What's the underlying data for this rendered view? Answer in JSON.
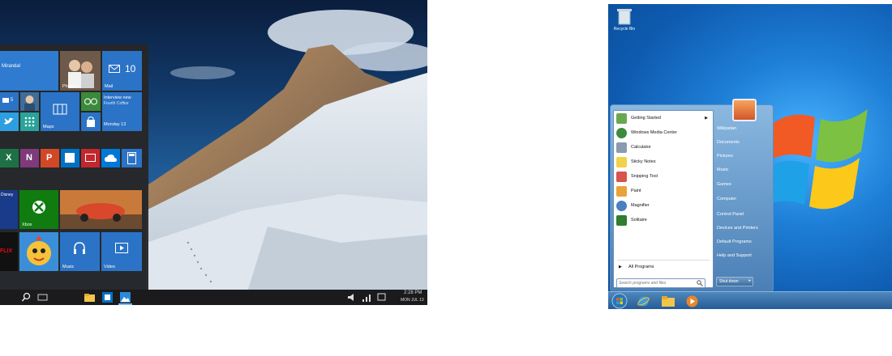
{
  "win10": {
    "start": {
      "tiles": {
        "people_name": "Miranda!",
        "mail_label": "Mail",
        "mail_count": "10",
        "photos_label": "Photos",
        "people_count": "5",
        "maps_label": "Maps",
        "interview_title": "Interview new",
        "interview_sub": "Fourth Coffee",
        "interview_date": "Monday 13",
        "xbox_label": "Xbox",
        "music_label": "Music",
        "video_label": "Video",
        "flix_label": "FLIX",
        "disney_label": "Disney"
      }
    },
    "taskbar": {
      "time": "2:28 PM",
      "date": "MON JUL 13"
    }
  },
  "win7": {
    "desktop": {
      "recycle_bin_label": "Recycle Bin"
    },
    "start_menu": {
      "programs": [
        {
          "label": "Getting Started",
          "icon": "getting-started-icon",
          "color": "#6aa84f"
        },
        {
          "label": "Windows Media Center",
          "icon": "media-center-icon",
          "color": "#3d8a3d"
        },
        {
          "label": "Calculator",
          "icon": "calculator-icon",
          "color": "#8a9bb0"
        },
        {
          "label": "Sticky Notes",
          "icon": "sticky-notes-icon",
          "color": "#f2d24a"
        },
        {
          "label": "Snipping Tool",
          "icon": "snipping-tool-icon",
          "color": "#d9534f"
        },
        {
          "label": "Paint",
          "icon": "paint-icon",
          "color": "#e8a33c"
        },
        {
          "label": "Magnifier",
          "icon": "magnifier-icon",
          "color": "#4a7fc1"
        },
        {
          "label": "Solitaire",
          "icon": "solitaire-icon",
          "color": "#2f7d2f"
        }
      ],
      "all_programs_label": "All Programs",
      "search_placeholder": "Search programs and files",
      "right_items": [
        "Wikipetan",
        "Documents",
        "Pictures",
        "Music",
        "Games",
        "Computer",
        "Control Panel",
        "Devices and Printers",
        "Default Programs",
        "Help and Support"
      ],
      "shutdown_label": "Shut down"
    }
  }
}
